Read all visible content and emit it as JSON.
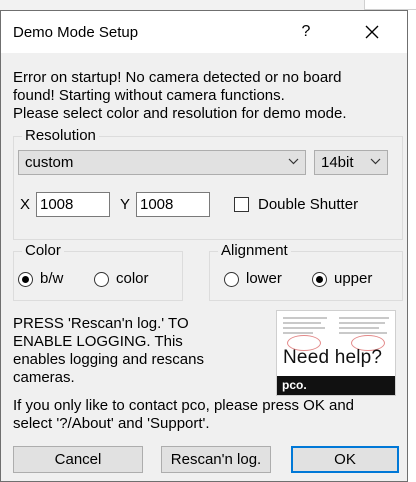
{
  "window": {
    "title": "Demo Mode Setup",
    "help_glyph": "?",
    "close_icon": "close-icon"
  },
  "intro_lines": [
    "Error on startup! No camera detected or no board",
    "found! Starting without camera functions.",
    "Please select color and resolution for demo mode."
  ],
  "resolution": {
    "group_label": "Resolution",
    "preset_value": "custom",
    "bitdepth_value": "14bit",
    "x_label": "X",
    "x_value": "1008",
    "y_label": "Y",
    "y_value": "1008",
    "double_shutter_label": "Double Shutter",
    "double_shutter_checked": false
  },
  "color": {
    "group_label": "Color",
    "options": [
      {
        "label": "b/w",
        "checked": true
      },
      {
        "label": "color",
        "checked": false
      }
    ]
  },
  "alignment": {
    "group_label": "Alignment",
    "options": [
      {
        "label": "lower",
        "checked": false
      },
      {
        "label": "upper",
        "checked": true
      }
    ]
  },
  "notice_lines": [
    "PRESS 'Rescan'n log.' TO",
    "ENABLE LOGGING. This",
    "enables logging and rescans",
    "cameras."
  ],
  "help_image": {
    "caption": "Need help?",
    "brand": "pco."
  },
  "contact_lines": [
    "If you only like to contact pco, please press OK and",
    "select '?/About' and 'Support'."
  ],
  "buttons": {
    "cancel": "Cancel",
    "rescan": "Rescan'n log.",
    "ok": "OK"
  },
  "colors": {
    "dialog_bg": "#f0f0f0",
    "default_button_border": "#0078d7"
  }
}
